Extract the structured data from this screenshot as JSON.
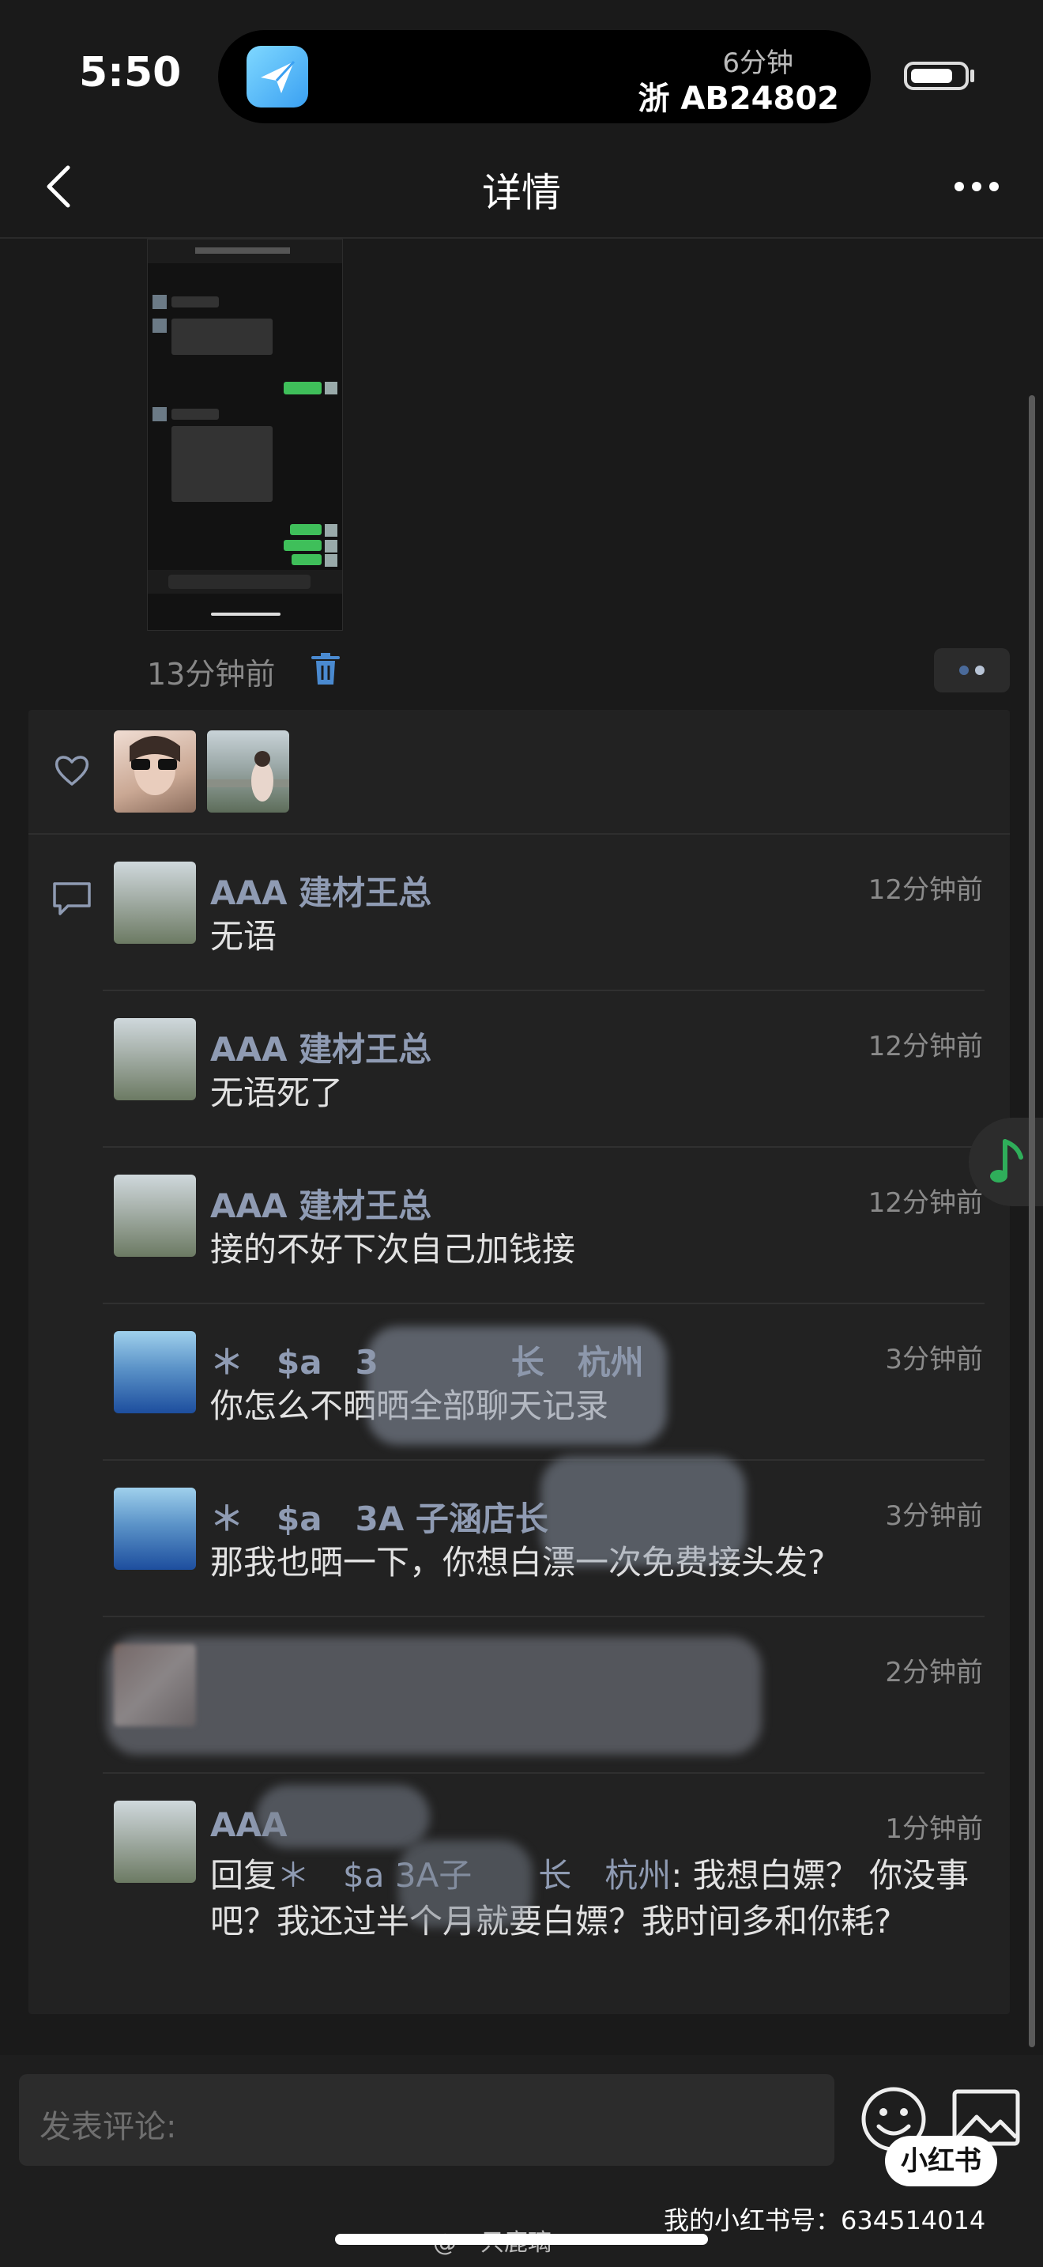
{
  "status_bar": {
    "time": "5:50",
    "live_activity": {
      "duration": "6分钟",
      "plate": "浙 AB24802",
      "app_icon": "paper-plane-icon"
    }
  },
  "nav": {
    "title": "详情",
    "back_icon": "chevron-left-icon",
    "more_icon": "more-dots-icon"
  },
  "post": {
    "time": "13分钟前",
    "delete_icon": "trash-icon"
  },
  "likes": {
    "icon": "heart-icon"
  },
  "comments": {
    "icon": "comment-icon",
    "items": [
      {
        "name": "AAA 建材王总",
        "time": "12分钟前",
        "text": "无语"
      },
      {
        "name": "AAA 建材王总",
        "time": "12分钟前",
        "text": "无语死了"
      },
      {
        "name": "AAA 建材王总",
        "time": "12分钟前",
        "text": "接的不好下次自己加钱接"
      },
      {
        "name": "＊　$a　3　　　　长　杭州",
        "time": "3分钟前",
        "text": "你怎么不晒晒全部聊天记录"
      },
      {
        "name": "＊　$a　3A 子涵店长",
        "time": "3分钟前",
        "text": "那我也晒一下，你想白漂一次免费接头发?"
      },
      {
        "name": "",
        "time": "2分钟前",
        "text": ""
      },
      {
        "name": "AAA",
        "time": "1分钟前",
        "reply_prefix": "回复",
        "reply_target": "＊　$a  3A子　　长　杭州",
        "text": ": 我想白嫖？ 你没事吧？我还过半个月就要白嫖？我时间多和你耗?"
      }
    ]
  },
  "bottom": {
    "input_placeholder": "发表评论:",
    "emoji_icon": "emoji-icon",
    "image_icon": "image-icon",
    "badge": "小红书",
    "watermark_id": "我的小红书号：634514014",
    "weibo_watermark": "@一只鹿璃"
  }
}
